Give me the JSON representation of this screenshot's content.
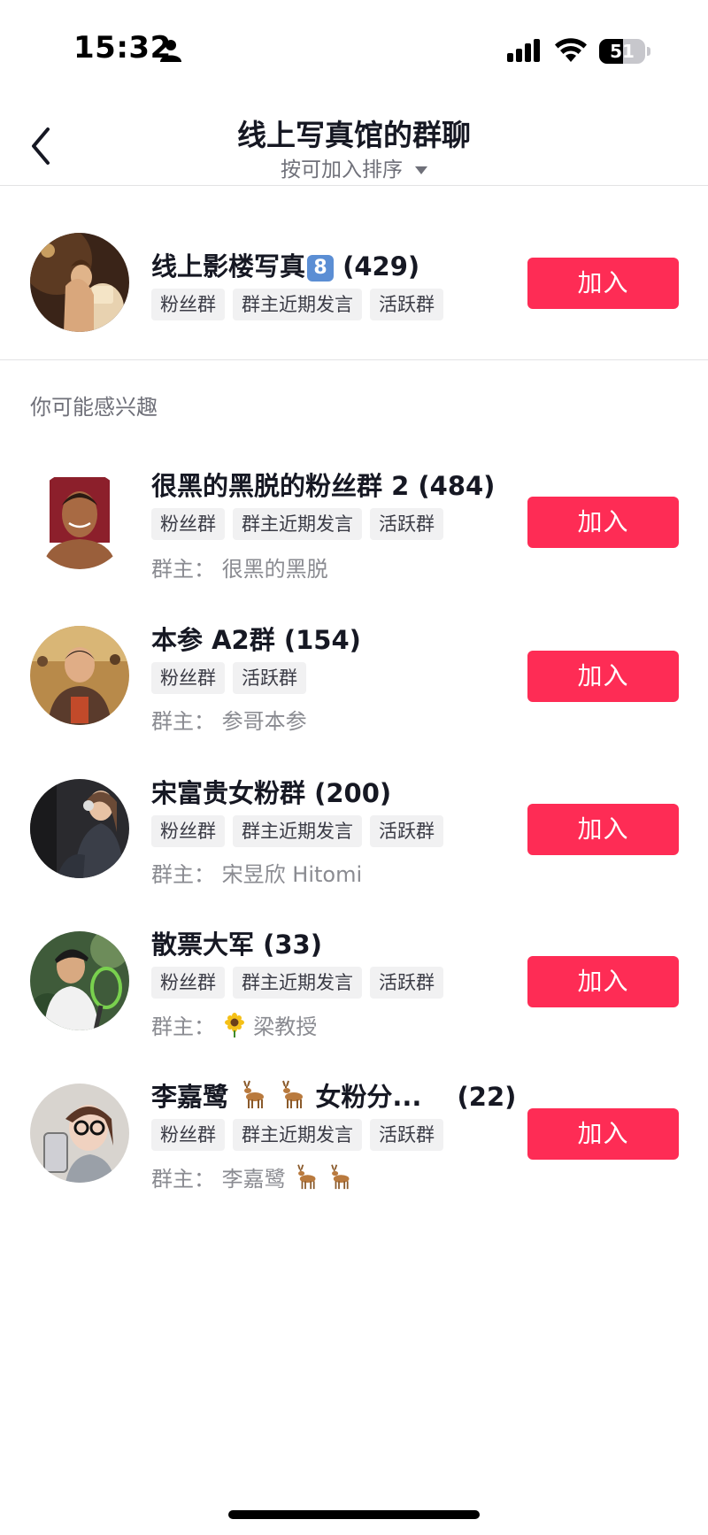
{
  "status_bar": {
    "time": "15:32",
    "battery_level": "51",
    "icons": [
      "person-icon",
      "signal-icon",
      "wifi-icon",
      "battery-icon"
    ]
  },
  "nav": {
    "title": "线上写真馆的群聊",
    "sort_label": "按可加入排序",
    "icons": [
      "back-arrow-icon",
      "caret-down-icon"
    ]
  },
  "top_group": {
    "name": "线上影楼写真",
    "badge": "8",
    "count": "(429)",
    "tags": [
      "粉丝群",
      "群主近期发言",
      "活跃群"
    ],
    "join_label": "加入"
  },
  "section_title": "你可能感兴趣",
  "groups": [
    {
      "name": "很黑的黑脱的粉丝群 2",
      "count": "(484)",
      "tags": [
        "粉丝群",
        "群主近期发言",
        "活跃群"
      ],
      "owner_label": "群主：",
      "owner": "很黑的黑脱",
      "join_label": "加入"
    },
    {
      "name": "本参 A2群",
      "count": "(154)",
      "tags": [
        "粉丝群",
        "活跃群"
      ],
      "owner_label": "群主：",
      "owner": "参哥本参",
      "join_label": "加入"
    },
    {
      "name": "宋富贵女粉群",
      "count": "(200)",
      "tags": [
        "粉丝群",
        "群主近期发言",
        "活跃群"
      ],
      "owner_label": "群主：",
      "owner": "宋昱欣 Hitomi",
      "join_label": "加入"
    },
    {
      "name": "散票大军",
      "count": "(33)",
      "tags": [
        "粉丝群",
        "群主近期发言",
        "活跃群"
      ],
      "owner_label": "群主：",
      "owner": "梁教授",
      "owner_emoji": "sunflower-icon",
      "join_label": "加入"
    },
    {
      "name": "李嘉鹭",
      "name_suffix": "女粉分...",
      "count": "(22)",
      "tags": [
        "粉丝群",
        "群主近期发言",
        "活跃群"
      ],
      "owner_label": "群主：",
      "owner": "李嘉鹭",
      "name_emoji": "deer-icon",
      "join_label": "加入"
    }
  ],
  "colors": {
    "accent": "#fe2c55",
    "text_primary": "#161823",
    "text_secondary": "#8a8b91",
    "tag_bg": "#f1f1f2"
  }
}
